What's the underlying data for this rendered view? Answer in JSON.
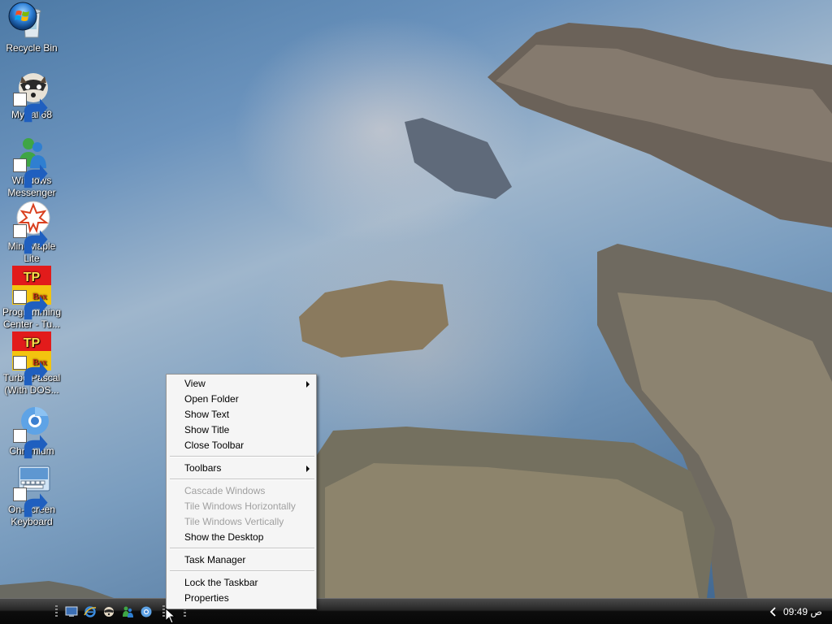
{
  "desktop_icons": [
    {
      "label": "Recycle Bin",
      "icon": "recycle-bin-icon",
      "shortcut": false
    },
    {
      "label": "MyPal 68",
      "icon": "raccoon-icon",
      "shortcut": true
    },
    {
      "label": "Windows Messenger",
      "icon": "messenger-icon",
      "shortcut": true
    },
    {
      "label": "MindMaple Lite",
      "icon": "mindmaple-icon",
      "shortcut": true
    },
    {
      "label": "Programming Center - Tu...",
      "icon": "turbo-pascal-icon",
      "shortcut": true
    },
    {
      "label": "Turbo Pascal (With DOS...",
      "icon": "turbo-pascal-icon",
      "shortcut": true
    },
    {
      "label": "Chromium",
      "icon": "chromium-icon",
      "shortcut": true
    },
    {
      "label": "On-Screen Keyboard",
      "icon": "keyboard-icon",
      "shortcut": true
    }
  ],
  "tp_icon_text": {
    "top": "TP",
    "bottom": "Bax"
  },
  "context_menu": {
    "items": [
      {
        "label": "View",
        "submenu": true,
        "enabled": true
      },
      {
        "label": "Open Folder",
        "submenu": false,
        "enabled": true
      },
      {
        "label": "Show Text",
        "submenu": false,
        "enabled": true
      },
      {
        "label": "Show Title",
        "submenu": false,
        "enabled": true
      },
      {
        "label": "Close Toolbar",
        "submenu": false,
        "enabled": true
      },
      {
        "label": "Toolbars",
        "submenu": true,
        "enabled": true
      },
      {
        "label": "Cascade Windows",
        "submenu": false,
        "enabled": false
      },
      {
        "label": "Tile Windows Horizontally",
        "submenu": false,
        "enabled": false
      },
      {
        "label": "Tile Windows Vertically",
        "submenu": false,
        "enabled": false
      },
      {
        "label": "Show the Desktop",
        "submenu": false,
        "enabled": true
      },
      {
        "label": "Task Manager",
        "submenu": false,
        "enabled": true
      },
      {
        "label": "Lock the Taskbar",
        "submenu": false,
        "enabled": true
      },
      {
        "label": "Properties",
        "submenu": false,
        "enabled": true
      }
    ]
  },
  "taskbar": {
    "quick_launch": [
      "show-desktop-icon",
      "internet-explorer-icon",
      "raccoon-icon",
      "messenger-icon",
      "chromium-icon"
    ],
    "clock": "09:49 ص"
  },
  "colors": {
    "start_orb": "#2d7fd6",
    "menu_bg": "#f5f5f5",
    "disabled_text": "#a0a0a0"
  }
}
